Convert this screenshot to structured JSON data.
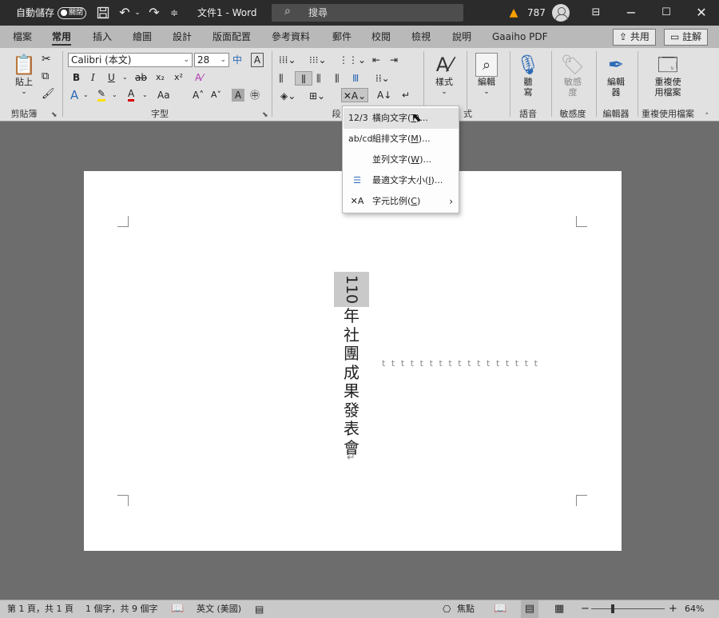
{
  "titlebar": {
    "autosave_label": "自動儲存",
    "autosave_state": "關閉",
    "doc_title": "文件1 - Word",
    "search_placeholder": "搜尋",
    "warning_count": "787",
    "icons": [
      "save-icon",
      "undo-icon",
      "redo-icon",
      "customize-qat-icon",
      "ribbon-display-icon",
      "minimize-icon",
      "maximize-icon",
      "close-icon"
    ]
  },
  "tabs": [
    "檔案",
    "常用",
    "插入",
    "繪圖",
    "設計",
    "版面配置",
    "參考資料",
    "郵件",
    "校閱",
    "檢視",
    "說明",
    "Gaaiho PDF"
  ],
  "active_tab": "常用",
  "share_label": "共用",
  "comments_label": "註解",
  "ribbon": {
    "clipboard": {
      "paste": "貼上",
      "group": "剪貼簿"
    },
    "font": {
      "name": "Calibri (本文)",
      "size": "28",
      "group": "字型",
      "bold": "B",
      "italic": "I",
      "underline": "U",
      "strike": "ab",
      "subscript": "x₂",
      "superscript": "x²",
      "change_case": "Aa",
      "grow": "A˄",
      "shrink": "A˅",
      "char_shading": "A"
    },
    "paragraph": {
      "group": "段"
    },
    "styles": {
      "label": "樣式",
      "group": "樣式"
    },
    "editing": {
      "label": "編輯"
    },
    "voice": {
      "label": "聽寫",
      "group": "語音"
    },
    "sensitivity": {
      "label": "敏感度",
      "group": "敏感度"
    },
    "editor": {
      "label": "編輯器",
      "group": "編輯器"
    },
    "reuse": {
      "label": "重複使用檔案",
      "group": "重複使用檔案"
    }
  },
  "asian_layout_menu": [
    {
      "icon": "12/3",
      "label": "橫向文字(",
      "key": "T",
      "suffix": ")...",
      "hover": true
    },
    {
      "icon": "ab/cd",
      "label": "組排文字(",
      "key": "M",
      "suffix": ")...",
      "hover": false
    },
    {
      "icon": "",
      "label": "並列文字(",
      "key": "W",
      "suffix": ")...",
      "hover": false
    },
    {
      "icon": "☰",
      "label": "最適文字大小(",
      "key": "I",
      "suffix": ")...",
      "hover": false
    },
    {
      "icon": "✕A",
      "label": "字元比例(",
      "key": "C",
      "suffix": ")",
      "hover": false,
      "submenu": true
    }
  ],
  "document": {
    "horizontal_number": "110",
    "vertical_text": "年社團成果發表會",
    "paragraph_mark": "↵",
    "tab_dots": "ttttttttttttttttt"
  },
  "statusbar": {
    "page": "第 1 頁，共 1 頁",
    "words": "1 個字，共 9 個字",
    "language": "英文 (美國)",
    "focus": "焦點",
    "zoom_percent": "64%",
    "zoom_minus": "−",
    "zoom_plus": "+"
  },
  "colors": {
    "titlebar": "#2b2b2b",
    "tabbar": "#b9b9b9",
    "ribbon": "#e1e1e1",
    "canvas": "#6d6d6d",
    "warning": "#f7a200",
    "font_color_red": "#d90000",
    "highlight_yellow": "#ffe000",
    "accent_blue": "#2d6ab6"
  }
}
